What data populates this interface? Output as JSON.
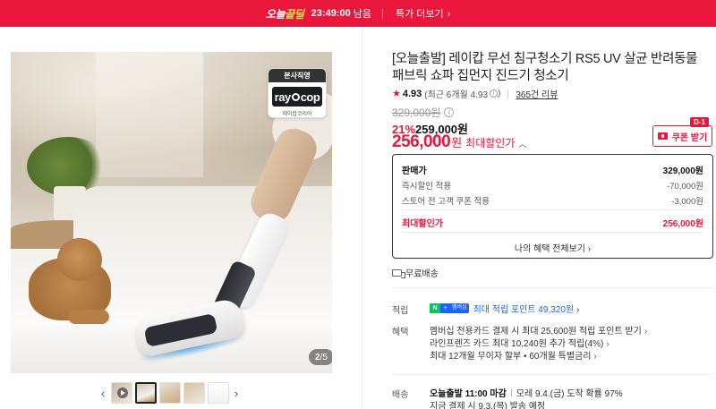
{
  "banner": {
    "deal_prefix": "오늘",
    "deal_highlight": "끝딜",
    "timer": "23:49:00",
    "timer_suffix": "남음",
    "more_label": "특가 더보기",
    "color": "#e8173b"
  },
  "gallery": {
    "brand_tag": "본사직영",
    "brand_logo_left": "ray",
    "brand_logo_right": "cop",
    "brand_sub": "레이캅코리아",
    "counter_current": "2",
    "counter_total": "/5",
    "prev_icon": "chevron-left-icon",
    "next_icon": "chevron-right-icon",
    "thumbnail_count": 5,
    "active_thumbnail": 2
  },
  "product": {
    "title": "[오늘출발] 레이캅 무선 침구청소기 RS5 UV 살균 반려동물 패브릭 쇼파 집먼지 진드기 청소기",
    "rating": "4.93",
    "rating_detail": "(최근 6개월 4.93",
    "rating_detail_close": ")",
    "review_count": "365건 리뷰",
    "original_price": "329,000원",
    "discount_pct": "21%",
    "sale_price": "259,000원",
    "max_discount_amount": "256,000",
    "max_discount_won": "원",
    "max_discount_label": "최대할인가",
    "coupon_label": "쿠폰 받기",
    "coupon_badge": "D-1",
    "accent_color": "#e8173b"
  },
  "price_box": {
    "rows": [
      {
        "label": "판매가",
        "value": "329,000원"
      },
      {
        "label": "즉시할인 적용",
        "value": "-70,000원"
      },
      {
        "label": "스토어 전 고객 쿠폰 적용",
        "value": "-3,000원"
      }
    ],
    "final_label": "최대할인가",
    "final_value": "256,000원",
    "link_label": "나의 혜택 전체보기"
  },
  "shipping_free": "무료배송",
  "points": {
    "label": "적립",
    "n_badge": "N",
    "plus_badge": "+",
    "member_badge": "멤버십",
    "link": "최대 적립 포인트 49,320원"
  },
  "benefits": {
    "label": "혜택",
    "lines": [
      "멤버십 전용카드 결제 시 최대 25,600원 적립 포인트 받기",
      "라인프렌즈 카드 최대 10,240원 추가 적립(4%)",
      "최대 12개월 무이자 할부 • 60개월 특별금리"
    ]
  },
  "delivery": {
    "label": "배송",
    "cutoff": "오늘출발 11:00 마감",
    "arrival": "모레 9.4.(금) 도착 확률 97%",
    "line2": "지금 결제 시 9.3.(목) 발송 예정"
  }
}
